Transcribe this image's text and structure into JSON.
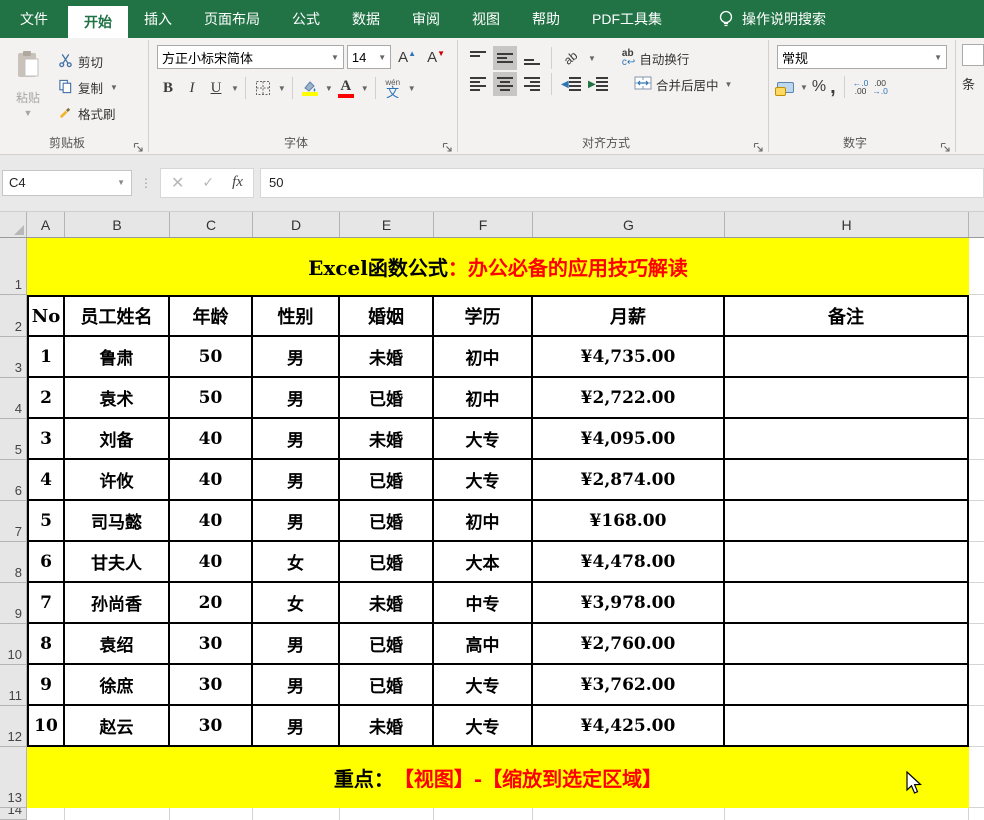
{
  "colors": {
    "brand_green": "#217346",
    "highlight_yellow": "#ffff00",
    "accent_red": "#ff0000"
  },
  "tab_bar": {
    "tabs": [
      {
        "label": "文件"
      },
      {
        "label": "开始"
      },
      {
        "label": "插入"
      },
      {
        "label": "页面布局"
      },
      {
        "label": "公式"
      },
      {
        "label": "数据"
      },
      {
        "label": "审阅"
      },
      {
        "label": "视图"
      },
      {
        "label": "帮助"
      },
      {
        "label": "PDF工具集"
      }
    ],
    "search_label": "操作说明搜索"
  },
  "ribbon": {
    "clipboard": {
      "group_label": "剪贴板",
      "paste_label": "粘贴",
      "cut_label": "剪切",
      "copy_label": "复制",
      "format_painter_label": "格式刷"
    },
    "font": {
      "group_label": "字体",
      "font_name": "方正小标宋简体",
      "font_size": "14",
      "bold_label": "B",
      "italic_label": "I",
      "underline_label": "U",
      "phonetic_pinyin": "wén",
      "phonetic_label": "文"
    },
    "alignment": {
      "group_label": "对齐方式",
      "wrap_label": "自动换行",
      "merge_label": "合并后居中",
      "orientation_glyph": "ab"
    },
    "number": {
      "group_label": "数字",
      "format_value": "常规",
      "percent_label": "%",
      "comma_label": ",",
      "inc_decimal_top": "←.0",
      "inc_decimal_bottom": ".00",
      "dec_decimal_top": ".00",
      "dec_decimal_bottom": "→.0"
    },
    "partial_next_group_text": "条"
  },
  "formula_bar": {
    "name_box": "C4",
    "cancel": "✕",
    "confirm": "✓",
    "fx": "fx",
    "value": "50"
  },
  "sheet": {
    "columns": [
      "A",
      "B",
      "C",
      "D",
      "E",
      "F",
      "G",
      "H"
    ],
    "row_numbers": [
      "1",
      "2",
      "3",
      "4",
      "5",
      "6",
      "7",
      "8",
      "9",
      "10",
      "11",
      "12",
      "13",
      "14"
    ],
    "title": {
      "black": "Excel函数公式",
      "red": "：办公必备的应用技巧解读"
    },
    "footer": {
      "black": "重点：",
      "red": "【视图】-【缩放到选定区域】"
    },
    "table": {
      "headers": [
        "No",
        "员工姓名",
        "年龄",
        "性别",
        "婚姻",
        "学历",
        "月薪",
        "备注"
      ],
      "rows": [
        [
          "1",
          "鲁肃",
          "50",
          "男",
          "未婚",
          "初中",
          "¥4,735.00",
          ""
        ],
        [
          "2",
          "袁术",
          "50",
          "男",
          "已婚",
          "初中",
          "¥2,722.00",
          ""
        ],
        [
          "3",
          "刘备",
          "40",
          "男",
          "未婚",
          "大专",
          "¥4,095.00",
          ""
        ],
        [
          "4",
          "许攸",
          "40",
          "男",
          "已婚",
          "大专",
          "¥2,874.00",
          ""
        ],
        [
          "5",
          "司马懿",
          "40",
          "男",
          "已婚",
          "初中",
          "¥168.00",
          ""
        ],
        [
          "6",
          "甘夫人",
          "40",
          "女",
          "已婚",
          "大本",
          "¥4,478.00",
          ""
        ],
        [
          "7",
          "孙尚香",
          "20",
          "女",
          "未婚",
          "中专",
          "¥3,978.00",
          ""
        ],
        [
          "8",
          "袁绍",
          "30",
          "男",
          "已婚",
          "高中",
          "¥2,760.00",
          ""
        ],
        [
          "9",
          "徐庶",
          "30",
          "男",
          "已婚",
          "大专",
          "¥3,762.00",
          ""
        ],
        [
          "10",
          "赵云",
          "30",
          "男",
          "未婚",
          "大专",
          "¥4,425.00",
          ""
        ]
      ]
    }
  }
}
